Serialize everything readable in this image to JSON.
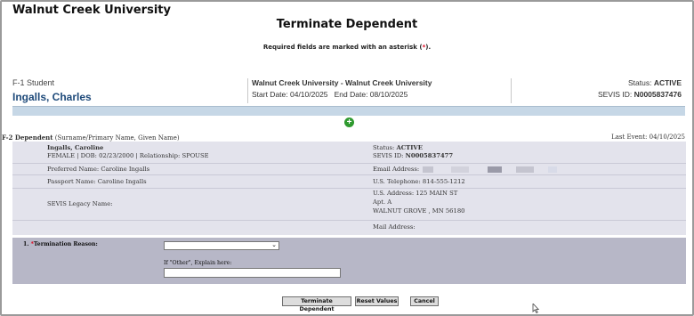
{
  "header": {
    "university": "Walnut Creek University",
    "page_title": "Terminate Dependent",
    "required_note_prefix": "Required fields are marked with an asterisk (",
    "required_note_star": "*",
    "required_note_suffix": ")."
  },
  "student": {
    "type_label": "F-1 Student",
    "name": "Ingalls, Charles",
    "program": "Walnut Creek University - Walnut Creek University",
    "start_date_label": "Start Date: 04/10/2025",
    "end_date_label": "End Date: 08/10/2025",
    "status_label": "Status:",
    "status_value": "ACTIVE",
    "sevis_label": "SEVIS ID:",
    "sevis_value": "N0005837476"
  },
  "dependent": {
    "section_label_bold": "F-2 Dependent",
    "section_label_rest": " (Surname/Primary Name, Given Name)",
    "last_event": "Last Event: 04/10/2025",
    "name": "Ingalls, Caroline",
    "details": "FEMALE | DOB: 02/23/2000 | Relationship: SPOUSE",
    "status_label": "Status:",
    "status_value": "ACTIVE",
    "sevis_label": "SEVIS ID:",
    "sevis_value": "N0005837477",
    "preferred_name": "Preferred Name: Caroline Ingalls",
    "email_label": "Email Address:",
    "email_value": "",
    "passport_name": "Passport Name: Caroline Ingalls",
    "telephone": "U.S. Telephone: 814-555-1212",
    "legacy_name": "SEVIS Legacy Name:",
    "address_line1": "U.S. Address: 125 MAIN ST",
    "address_line2": "Apt. A",
    "address_line3": "WALNUT GROVE , MN  56180",
    "mail_address": "Mail Address:"
  },
  "form": {
    "number": "1.",
    "star": "*",
    "reason_label": "Termination Reason:",
    "reason_value": "",
    "other_label": "If \"Other\", Explain here:",
    "other_value": ""
  },
  "buttons": {
    "terminate": "Terminate Dependent",
    "reset": "Reset Values",
    "cancel": "Cancel"
  },
  "icons": {
    "add": "plus-circle-icon",
    "dropdown": "chevron-down-icon",
    "cursor": "mouse-pointer-icon"
  },
  "colors": {
    "accent_blue": "#1e4a7a",
    "required_red": "#e0001b",
    "add_green": "#2f9a2f",
    "bar_blue": "#c6d7e6"
  }
}
